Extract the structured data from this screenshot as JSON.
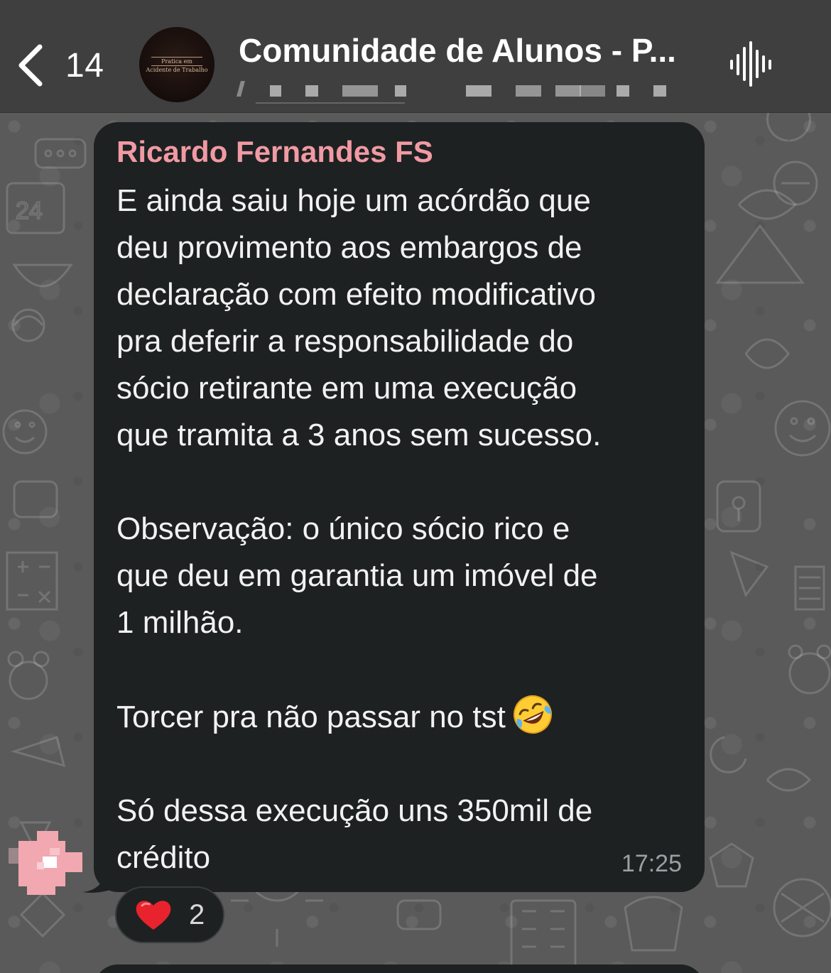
{
  "header": {
    "back_label": "",
    "unread_count": "14",
    "avatar_logo_line1": "Pratica em",
    "avatar_logo_line2": "Acidente de Trabalho",
    "title": "Comunidade de Alunos - P...",
    "voice_icon": "voice-wave-icon"
  },
  "message": {
    "sender": "Ricardo Fernandes FS",
    "sender_color": "#f09aa4",
    "text": "E ainda saiu hoje um acórdão que\ndeu provimento aos embargos de\ndeclaração com efeito modificativo\npra deferir a responsabilidade do\nsócio retirante em uma execução\nque tramita a 3 anos sem sucesso.\n\nObservação: o único sócio rico e\nque deu em garantia um imóvel de\n1 milhão.\n\nTorcer pra não passar no tst",
    "text_tail": "\n\nSó dessa execução uns 350mil de\ncrédito",
    "emoji": "rolling-on-floor-laughing-emoji",
    "time": "17:25"
  },
  "reaction": {
    "emoji": "red-heart-emoji",
    "count": "2"
  },
  "colors": {
    "header_bg": "#3f3f3f",
    "bubble_bg": "#1e2121",
    "wallpaper": "#5a5a5a"
  }
}
